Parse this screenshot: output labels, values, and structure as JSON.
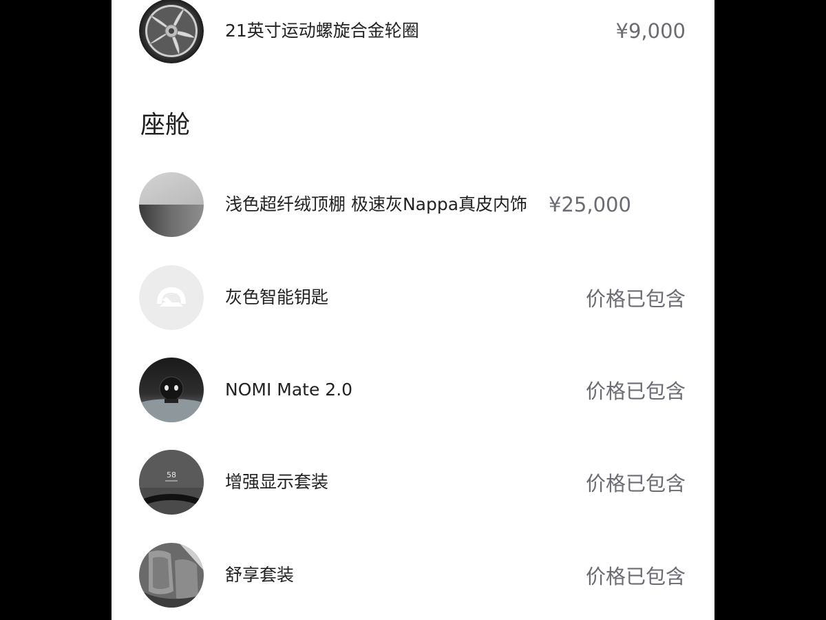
{
  "colors": {
    "background": "#000000",
    "panel": "#ffffff",
    "text_primary": "#222222",
    "text_price": "#6b6b73"
  },
  "wheel_item": {
    "icon": "alloy-wheel-icon",
    "name": "21英寸运动螺旋合金轮圈",
    "price": "¥9,000"
  },
  "cabin_section": {
    "title": "座舱",
    "items": [
      {
        "icon": "interior-swatch-icon",
        "name": "浅色超纤绒顶棚 极速灰Nappa真皮内饰",
        "price": "¥25,000"
      },
      {
        "icon": "smart-key-icon",
        "name": "灰色智能钥匙",
        "price": "价格已包含"
      },
      {
        "icon": "nomi-mate-icon",
        "name": "NOMI Mate 2.0",
        "price": "价格已包含"
      },
      {
        "icon": "hud-display-icon",
        "name": "增强显示套装",
        "price": "价格已包含",
        "hud_reading": "58"
      },
      {
        "icon": "seat-icon",
        "name": "舒享套装",
        "price": "价格已包含"
      }
    ]
  }
}
